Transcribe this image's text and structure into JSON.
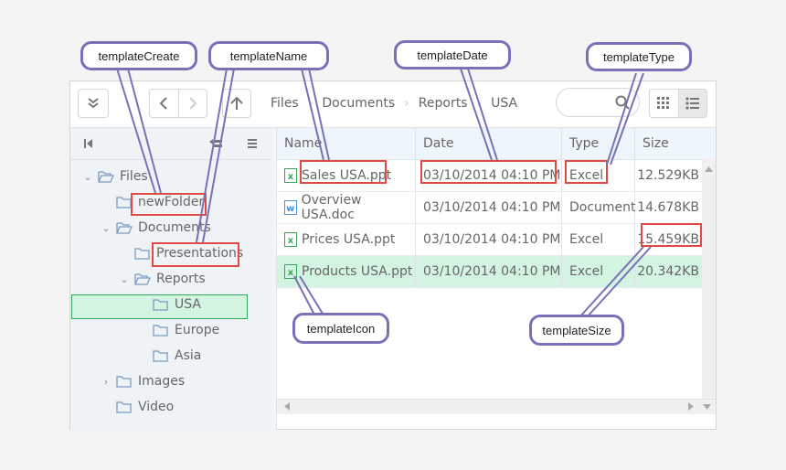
{
  "toolbar": {
    "breadcrumbs": [
      "Files",
      "Documents",
      "Reports",
      "USA"
    ],
    "search_placeholder": "",
    "icons": {
      "collapse": "double-chevron-down-icon",
      "back": "chevron-left-icon",
      "forward": "chevron-right-icon",
      "up": "arrow-up-icon",
      "search": "search-icon",
      "thumbnails": "grid-view-icon",
      "details": "list-view-icon"
    }
  },
  "tree": {
    "nodes": [
      {
        "label": "Files",
        "expanded": true
      },
      {
        "label": "newFolder"
      },
      {
        "label": "Documents",
        "expanded": true
      },
      {
        "label": "Presentations"
      },
      {
        "label": "Reports",
        "expanded": true
      },
      {
        "label": "USA",
        "selected": true
      },
      {
        "label": "Europe"
      },
      {
        "label": "Asia"
      },
      {
        "label": "Images",
        "expanded": false
      },
      {
        "label": "Video"
      }
    ]
  },
  "grid": {
    "columns": [
      "Name",
      "Date",
      "Type",
      "Size"
    ],
    "rows": [
      {
        "icon": "excel-file-icon",
        "name": "Sales USA.ppt",
        "date": "03/10/2014 04:10 PM",
        "type": "Excel",
        "size": "12.529KB"
      },
      {
        "icon": "word-file-icon",
        "name": "Overview USA.doc",
        "date": "03/10/2014 04:10 PM",
        "type": "Document",
        "size": "14.678KB"
      },
      {
        "icon": "excel-file-icon",
        "name": "Prices USA.ppt",
        "date": "03/10/2014 04:10 PM",
        "type": "Excel",
        "size": "15.459KB"
      },
      {
        "icon": "excel-file-icon",
        "name": "Products USA.ppt",
        "date": "03/10/2014 04:10 PM",
        "type": "Excel",
        "size": "20.342KB",
        "selected": true
      }
    ]
  },
  "callouts": {
    "create": "templateCreate",
    "name": "templateName",
    "date": "templateDate",
    "type": "templateType",
    "icon": "templateIcon",
    "size": "templateSize"
  },
  "colors": {
    "callout_border": "#7a70b8",
    "highlight_red": "#e04a42",
    "selected_green": "#d4f4e2"
  }
}
